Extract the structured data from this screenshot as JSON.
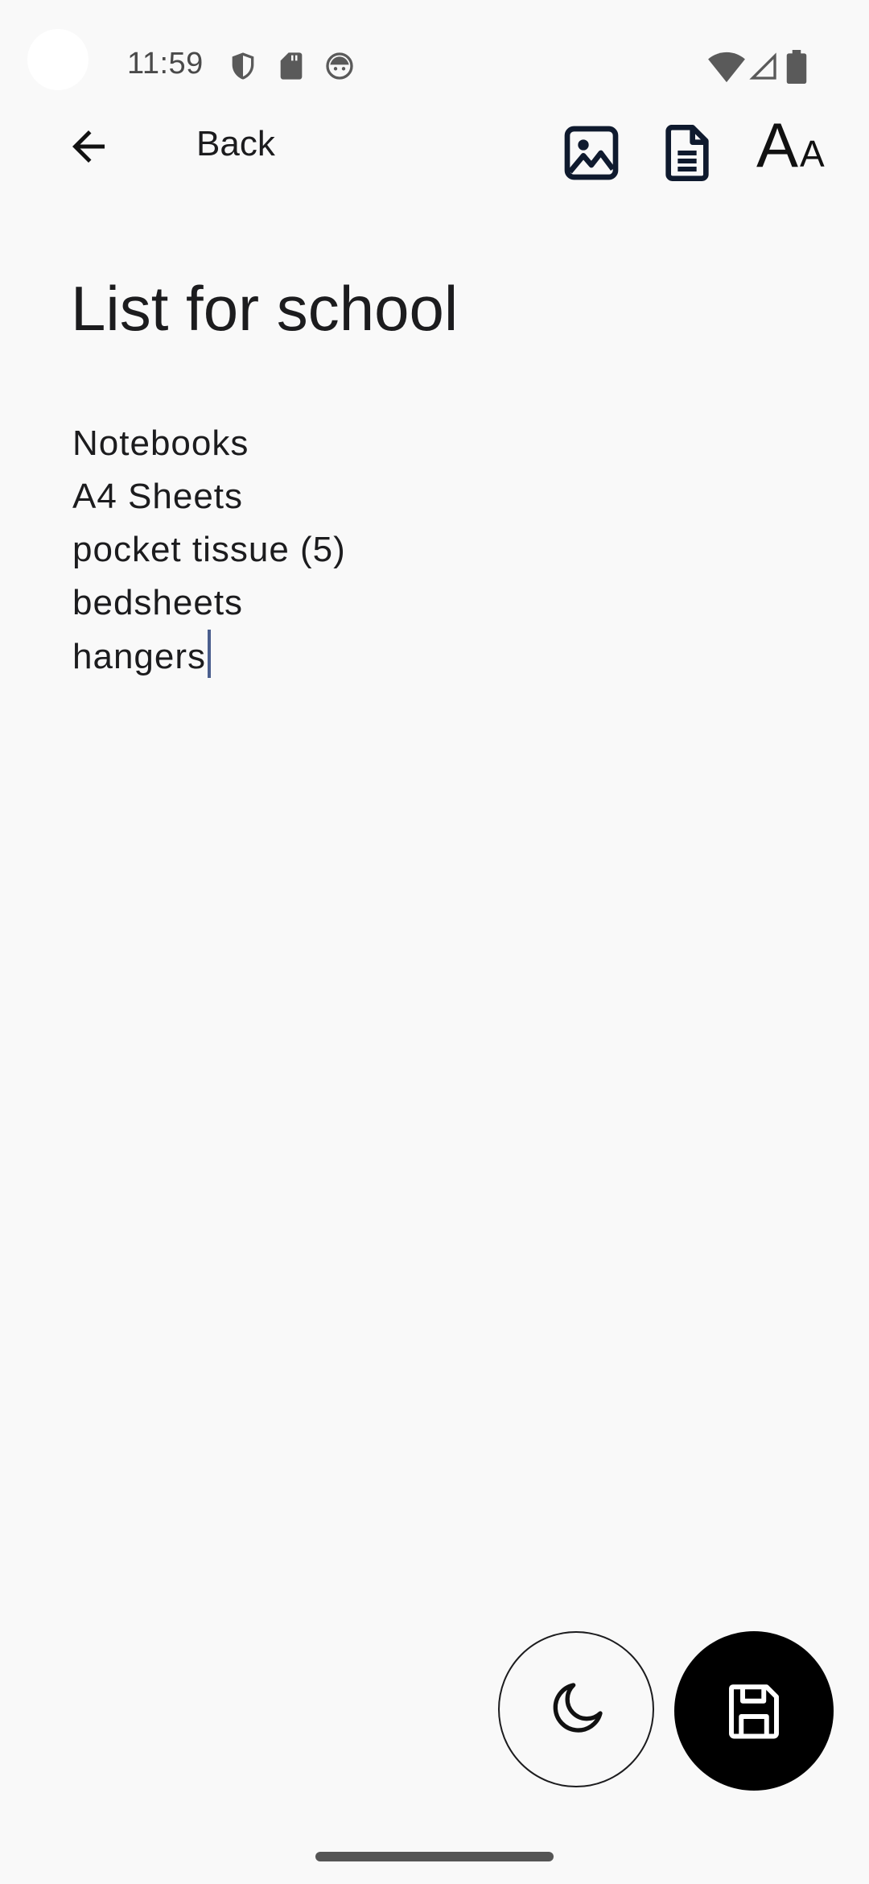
{
  "status_bar": {
    "time": "11:59",
    "icons": [
      "shield-icon",
      "sd-card-icon",
      "android-face-icon",
      "wifi-icon",
      "signal-icon",
      "battery-icon"
    ]
  },
  "app_bar": {
    "back_label": "Back",
    "actions": [
      "image-icon",
      "document-icon",
      "font-size-icon"
    ],
    "font_size_big": "A",
    "font_size_small": "A"
  },
  "note": {
    "title": "List for school",
    "lines": [
      "Notebooks",
      "A4 Sheets",
      "pocket tissue (5)",
      "bedsheets",
      "hangers"
    ]
  },
  "fabs": {
    "dark_mode_icon": "moon-icon",
    "save_icon": "save-icon"
  },
  "colors": {
    "background": "#f9f9f9",
    "text": "#1c1c1e",
    "caret": "#4b5f8e",
    "save_fab": "#000000"
  }
}
